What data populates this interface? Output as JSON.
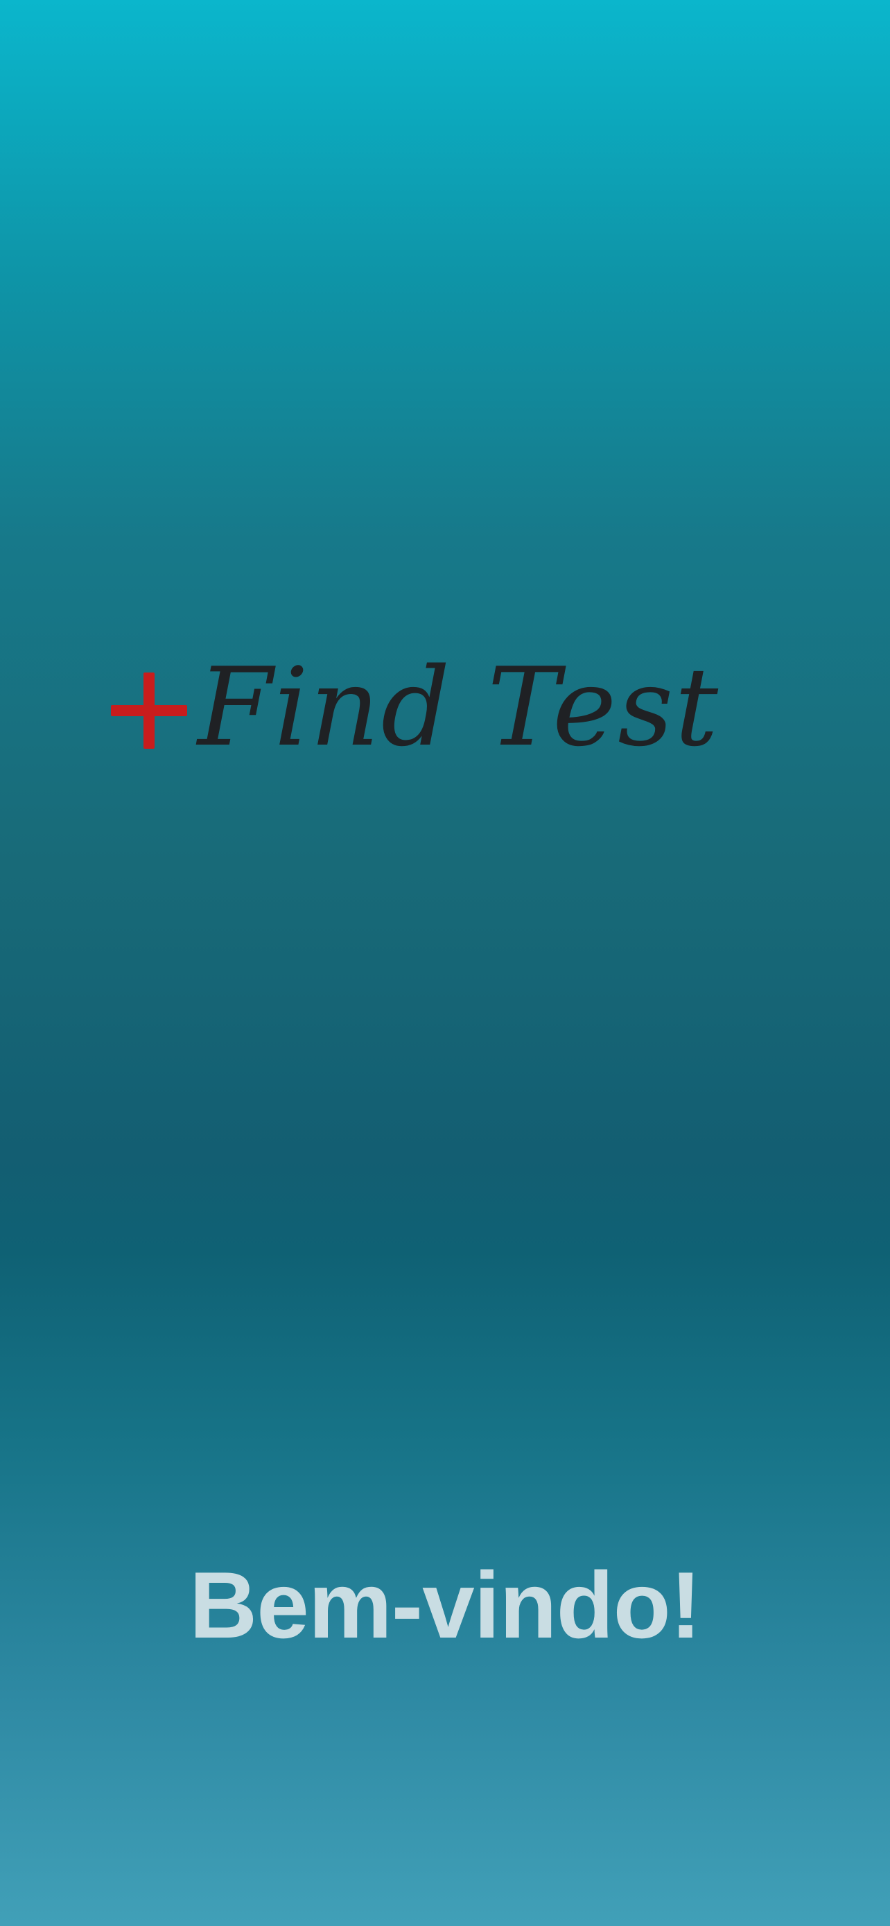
{
  "logo": {
    "plus_symbol": "+",
    "app_name": "Find Test",
    "plus_color": "#c81d1d",
    "text_color": "#1f2124"
  },
  "welcome": {
    "text": "Bem-vindo!"
  },
  "background": {
    "top_color": "#0bb6cc",
    "mid_color": "#0f6174",
    "bottom_color": "#41a0b8"
  }
}
